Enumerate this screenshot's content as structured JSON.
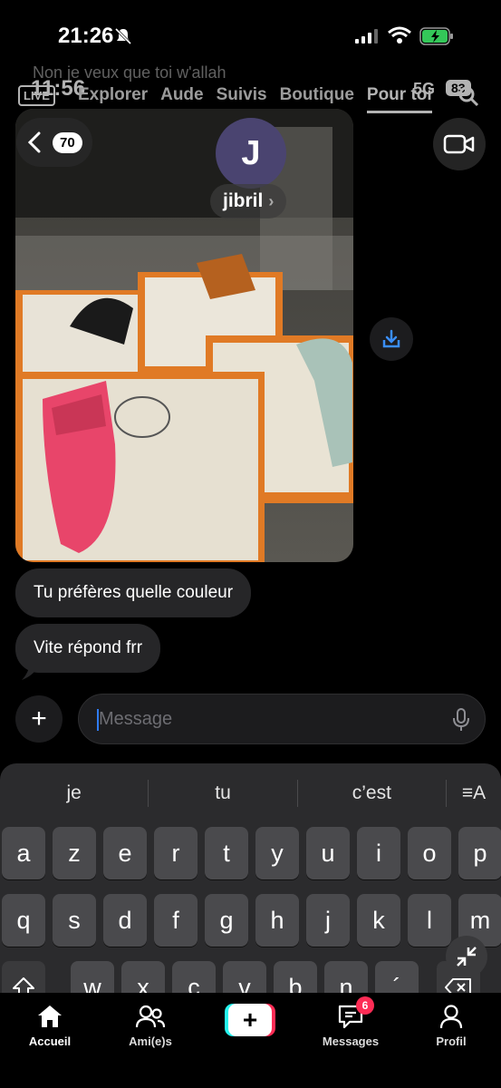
{
  "status_bar": {
    "time": "21:26"
  },
  "overlay": {
    "caption": "Non je veux que toi w'allah",
    "time": "11:56",
    "live": "LIVE",
    "tabs": [
      "Explorer",
      "Aude",
      "Suivis",
      "Boutique",
      "Pour toi"
    ],
    "network": "5G",
    "battery": "83"
  },
  "header": {
    "back_count": "70",
    "avatar_initial": "J",
    "contact_name": "jibril"
  },
  "messages": [
    {
      "text": "Tu préfères quelle couleur"
    },
    {
      "text": "Vite répond frr"
    }
  ],
  "composer": {
    "placeholder": "Message"
  },
  "keyboard": {
    "suggestions": [
      "je",
      "tu",
      "c’est"
    ],
    "row1": [
      "a",
      "z",
      "e",
      "r",
      "t",
      "y",
      "u",
      "i",
      "o",
      "p"
    ],
    "row2": [
      "q",
      "s",
      "d",
      "f",
      "g",
      "h",
      "j",
      "k",
      "l",
      "m"
    ],
    "row3": [
      "w",
      "x",
      "c",
      "v",
      "b",
      "n",
      "´"
    ]
  },
  "bottom_nav": {
    "home": "Accueil",
    "friends": "Ami(e)s",
    "messages": "Messages",
    "messages_badge": "6",
    "profile": "Profil"
  },
  "colors": {
    "accent_red": "#fe2c55",
    "accent_cyan": "#25f4ee",
    "cursor_blue": "#2f7cf6"
  }
}
